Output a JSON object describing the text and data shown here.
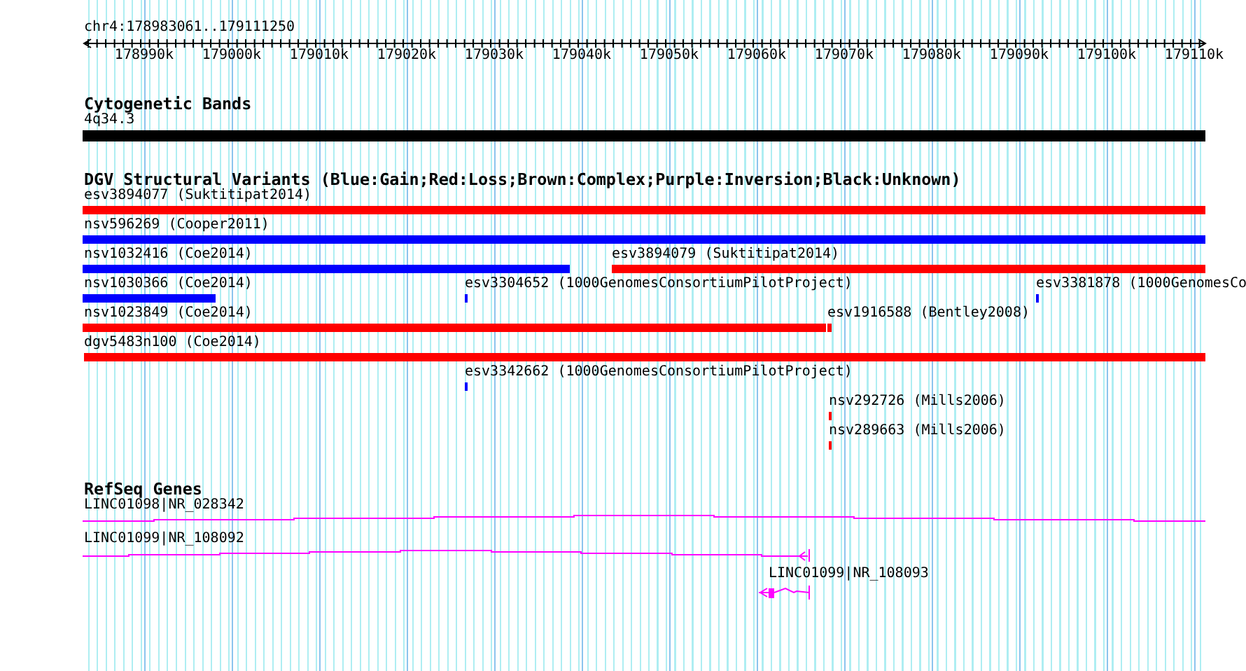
{
  "ruler": {
    "region": "chr4:178983061..179111250",
    "tick_labels": [
      "178990k",
      "179000k",
      "179010k",
      "179020k",
      "179030k",
      "179040k",
      "179050k",
      "179060k",
      "179070k",
      "179080k",
      "179090k",
      "179100k",
      "179110k"
    ]
  },
  "tracks": [
    {
      "kind": "cytoband",
      "title": "Cytogenetic Bands",
      "rows": [
        {
          "features": [
            {
              "label": "4q34.3",
              "color": "#000000"
            }
          ]
        }
      ]
    },
    {
      "kind": "variants",
      "title": "DGV Structural Variants (Blue:Gain;Red:Loss;Brown:Complex;Purple:Inversion;Black:Unknown)",
      "rows": [
        {
          "features": [
            {
              "label": "esv3894077 (Suktitipat2014)",
              "color": "#ff0000"
            }
          ]
        },
        {
          "features": [
            {
              "label": "nsv596269 (Cooper2011)",
              "color": "#0000ff"
            }
          ]
        },
        {
          "features": [
            {
              "label": "nsv1032416 (Coe2014)",
              "color": "#0000ff"
            },
            {
              "label": "esv3894079 (Suktitipat2014)",
              "color": "#ff0000"
            }
          ]
        },
        {
          "features": [
            {
              "label": "nsv1030366 (Coe2014)",
              "color": "#0000ff"
            },
            {
              "label": "esv3304652 (1000GenomesConsortiumPilotProject)",
              "color": "#0000ff"
            },
            {
              "label": "esv3381878 (1000GenomesCo",
              "color": "#0000ff"
            }
          ]
        },
        {
          "features": [
            {
              "label": "nsv1023849 (Coe2014)",
              "color": "#ff0000"
            },
            {
              "label": "esv1916588 (Bentley2008)",
              "color": "#ff0000"
            }
          ]
        },
        {
          "features": [
            {
              "label": "dgv5483n100 (Coe2014)",
              "color": "#ff0000"
            }
          ]
        },
        {
          "features": [
            {
              "label": "esv3342662 (1000GenomesConsortiumPilotProject)",
              "color": "#0000ff"
            }
          ]
        },
        {
          "features": [
            {
              "label": "nsv292726 (Mills2006)",
              "color": "#ff0000"
            }
          ]
        },
        {
          "features": [
            {
              "label": "nsv289663 (Mills2006)",
              "color": "#ff0000"
            }
          ]
        }
      ]
    },
    {
      "kind": "genes",
      "title": "RefSeq Genes",
      "rows": [
        {
          "features": [
            {
              "label": "LINC01098|NR_028342",
              "color": "#ff00ff"
            }
          ]
        },
        {
          "features": [
            {
              "label": "LINC01099|NR_108092",
              "color": "#ff00ff"
            }
          ]
        },
        {
          "features": [
            {
              "label": "LINC01099|NR_108093",
              "color": "#ff00ff"
            }
          ]
        }
      ]
    }
  ]
}
